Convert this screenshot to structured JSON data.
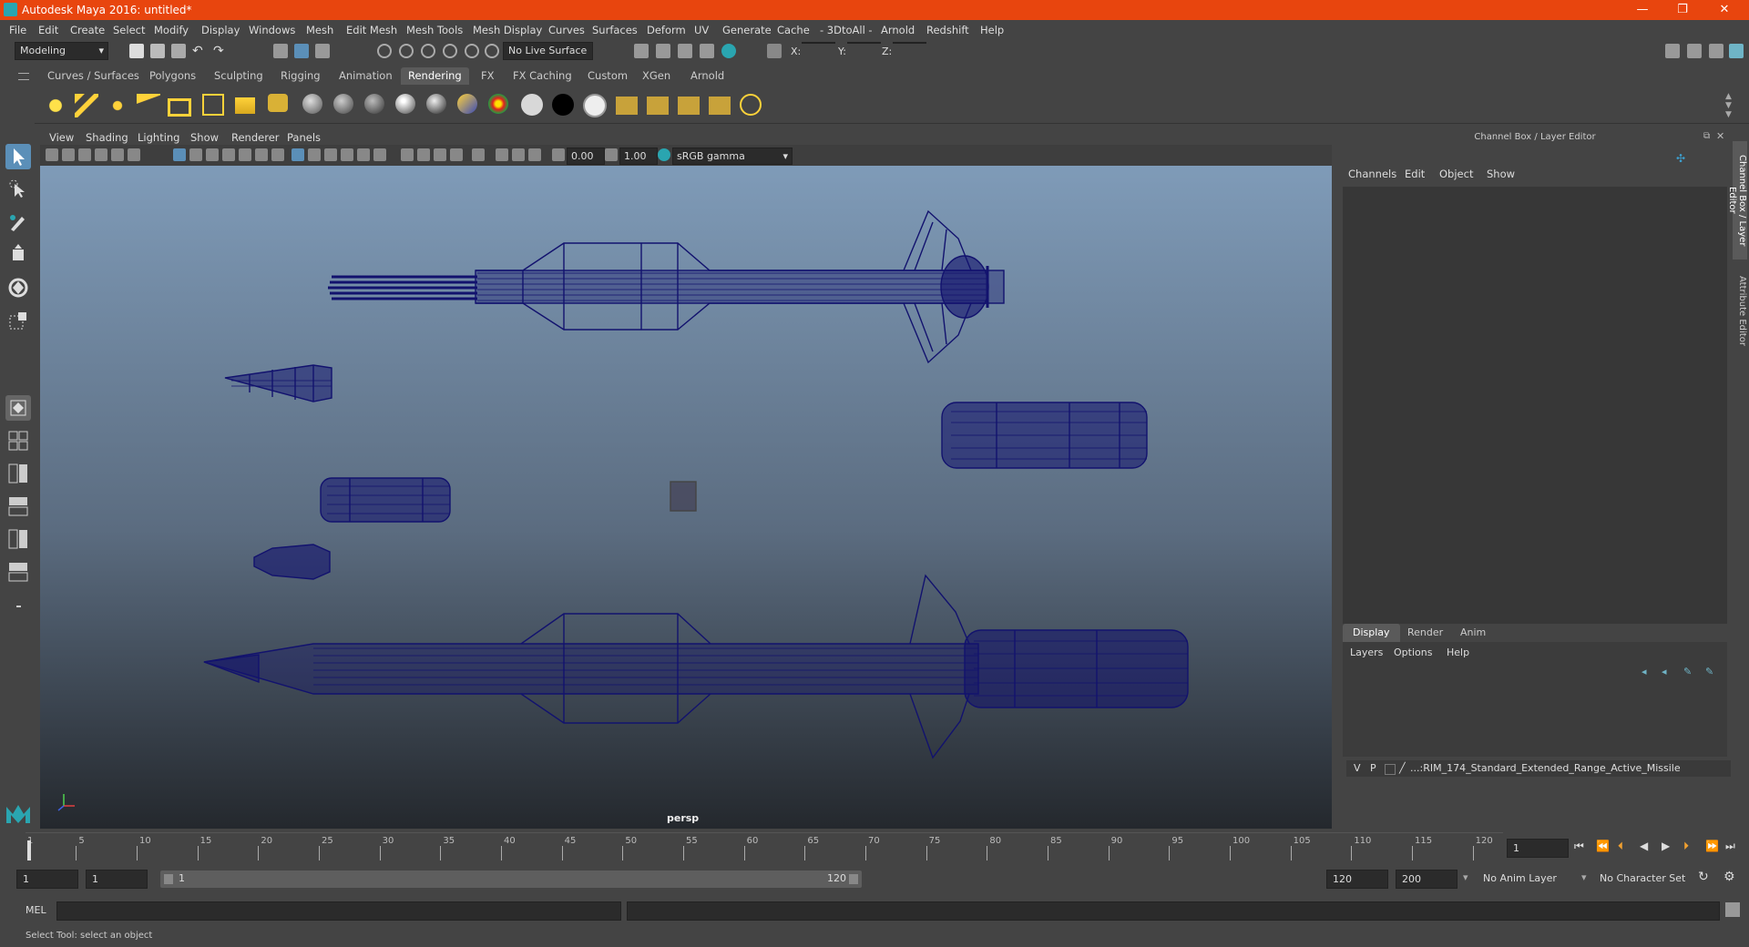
{
  "titlebar": {
    "title": "Autodesk Maya 2016: untitled*",
    "minimize": "—",
    "maximize": "❐",
    "close": "✕"
  },
  "menu": [
    "File",
    "Edit",
    "Create",
    "Select",
    "Modify",
    "Display",
    "Windows",
    "Mesh",
    "Edit Mesh",
    "Mesh Tools",
    "Mesh Display",
    "Curves",
    "Surfaces",
    "Deform",
    "UV",
    "Generate",
    "Cache",
    "- 3DtoAll -",
    "Arnold",
    "Redshift",
    "Help"
  ],
  "statusline": {
    "mode": "Modeling",
    "live_surface": "No Live Surface",
    "x_label": "X:",
    "y_label": "Y:",
    "z_label": "Z:"
  },
  "shelf_tabs": [
    "Curves / Surfaces",
    "Polygons",
    "Sculpting",
    "Rigging",
    "Animation",
    "Rendering",
    "FX",
    "FX Caching",
    "Custom",
    "XGen",
    "Arnold"
  ],
  "active_shelf": "Rendering",
  "viewport": {
    "menu": [
      "View",
      "Shading",
      "Lighting",
      "Show",
      "Renderer",
      "Panels"
    ],
    "exposure": "0.00",
    "gamma": "1.00",
    "color_space": "sRGB gamma",
    "camera_label": "persp"
  },
  "channel_box": {
    "title": "Channel Box / Layer Editor",
    "menu": [
      "Channels",
      "Edit",
      "Object",
      "Show"
    ],
    "layer_tabs": [
      "Display",
      "Render",
      "Anim"
    ],
    "active_layer_tab": "Display",
    "layer_menu": [
      "Layers",
      "Options",
      "Help"
    ],
    "layer": {
      "v": "V",
      "p": "P",
      "name": "...:RIM_174_Standard_Extended_Range_Active_Missile"
    }
  },
  "side_tabs": [
    "Channel Box / Layer Editor",
    "Attribute Editor"
  ],
  "timeline": {
    "labels": [
      "5",
      "10",
      "15",
      "20",
      "25",
      "30",
      "35",
      "40",
      "45",
      "50",
      "55",
      "60",
      "65",
      "70",
      "75",
      "80",
      "85",
      "90",
      "95",
      "100",
      "105",
      "110",
      "115",
      "120"
    ],
    "start_label": "1",
    "current_frame": "1"
  },
  "range": {
    "start": "1",
    "playback_start": "1",
    "slider_start": "1",
    "slider_end": "120",
    "playback_end": "120",
    "end": "200",
    "anim_layer": "No Anim Layer",
    "character_set": "No Character Set"
  },
  "command": {
    "lang": "MEL"
  },
  "help_line": "Select Tool: select an object",
  "colors": {
    "titlebar": "#e8450e",
    "wire": "#12126e",
    "accent": "#2aa5b0"
  }
}
